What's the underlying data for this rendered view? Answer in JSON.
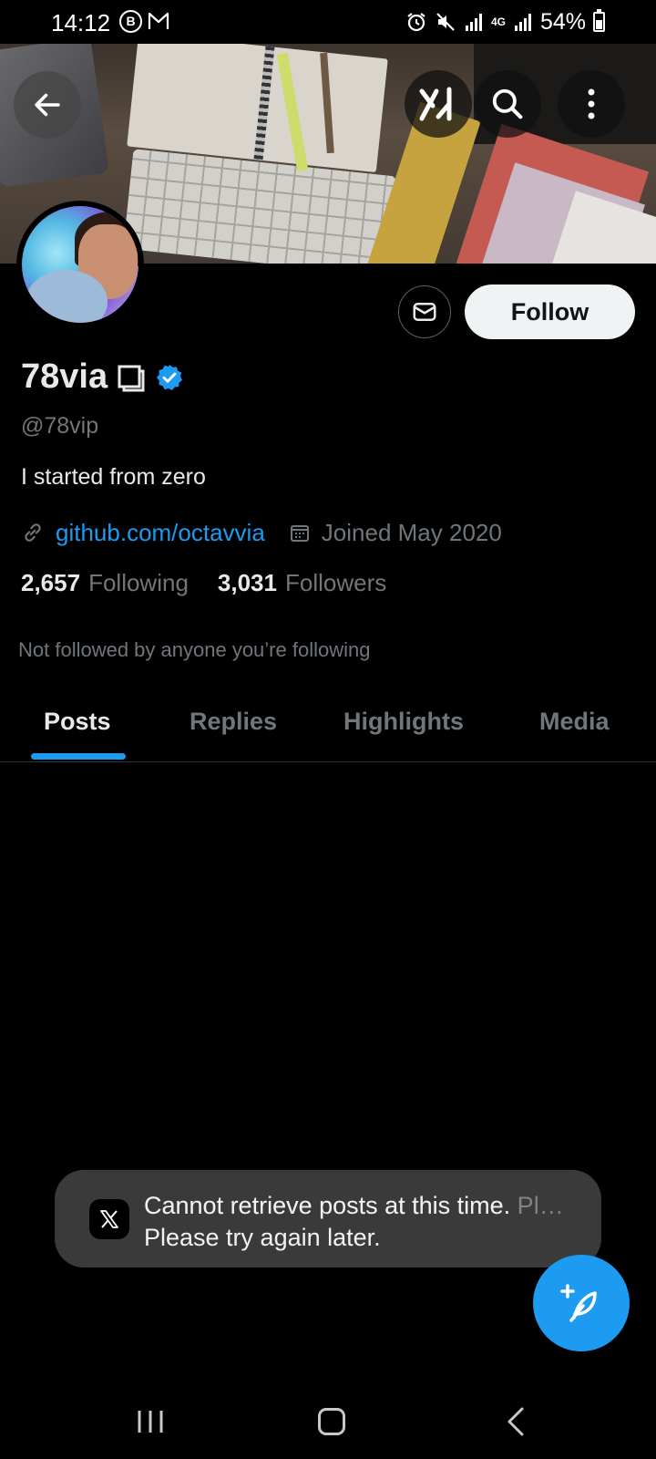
{
  "status_bar": {
    "time": "14:12",
    "battery": "54%",
    "battery_level": 0.54,
    "network": "4G"
  },
  "header": {
    "back_icon": "arrow-left-icon",
    "grok_icon": "grok-icon",
    "search_icon": "search-icon",
    "more_icon": "more-vertical-icon"
  },
  "profile": {
    "display_name": "78via",
    "handle": "@78vip",
    "bio": "I started from zero",
    "link": "github.com/octavvia",
    "joined": "Joined May 2020",
    "following_count": "2,657",
    "following_label": "Following",
    "followers_count": "3,031",
    "followers_label": "Followers",
    "not_followed_text": "Not followed by anyone you’re following",
    "follow_label": "Follow"
  },
  "tabs": [
    {
      "label": "Posts",
      "active": true
    },
    {
      "label": "Replies",
      "active": false
    },
    {
      "label": "Highlights",
      "active": false
    },
    {
      "label": "Media",
      "active": false
    }
  ],
  "toast": {
    "message": "Cannot retrieve posts at this time. Please try again later.",
    "ghost_message": "Cannot retrieve posts at this time. Please try again la..."
  },
  "colors": {
    "accent": "#1d9bf0",
    "background": "#000000",
    "muted_text": "#71767b",
    "primary_text": "#e7e9ea"
  }
}
